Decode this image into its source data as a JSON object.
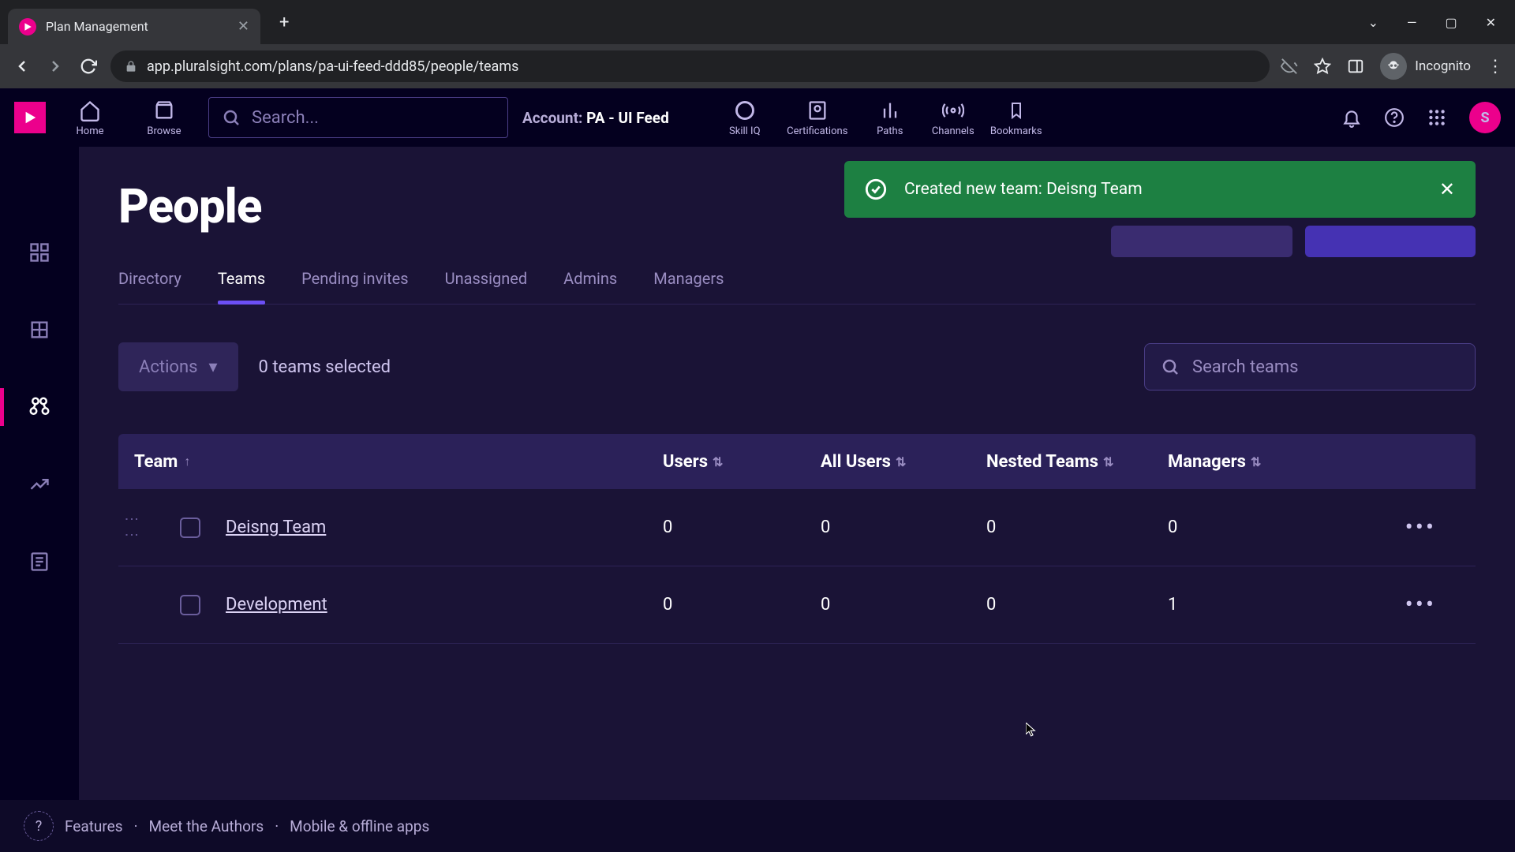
{
  "browser": {
    "tab_title": "Plan Management",
    "url": "app.pluralsight.com/plans/pa-ui-feed-ddd85/people/teams",
    "incognito_label": "Incognito"
  },
  "topnav": {
    "items": [
      {
        "label": "Home"
      },
      {
        "label": "Browse"
      }
    ],
    "search_placeholder": "Search...",
    "account_key": "Account:",
    "account_value": "PA - UI Feed",
    "right_items": [
      {
        "label": "Skill IQ"
      },
      {
        "label": "Certifications"
      },
      {
        "label": "Paths"
      },
      {
        "label": "Channels"
      },
      {
        "label": "Bookmarks"
      }
    ],
    "avatar_initial": "S"
  },
  "toast": {
    "message": "Created new team: Deisng Team"
  },
  "page": {
    "title": "People",
    "tabs": [
      "Directory",
      "Teams",
      "Pending invites",
      "Unassigned",
      "Admins",
      "Managers"
    ],
    "active_tab_index": 1,
    "actions_label": "Actions",
    "selection_text": "0 teams selected",
    "search_placeholder": "Search teams"
  },
  "table": {
    "columns": [
      "Team",
      "Users",
      "All Users",
      "Nested Teams",
      "Managers"
    ],
    "rows": [
      {
        "name": "Deisng Team",
        "users": "0",
        "all": "0",
        "nested": "0",
        "mgr": "0",
        "showDrag": true
      },
      {
        "name": "Development",
        "users": "0",
        "all": "0",
        "nested": "0",
        "mgr": "1",
        "showDrag": false
      }
    ]
  },
  "footer": {
    "links": [
      "Features",
      "Meet the Authors",
      "Mobile & offline apps"
    ]
  }
}
